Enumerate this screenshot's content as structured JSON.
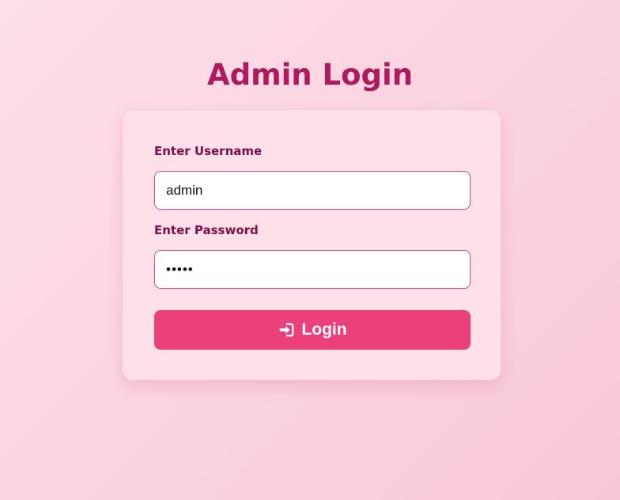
{
  "page": {
    "title": "Admin Login",
    "colors": {
      "title": "#b0195b",
      "label": "#7f0d45",
      "button": "#ec407a",
      "input_border": "#e0478a",
      "card_background": "#fde0e8"
    }
  },
  "form": {
    "username": {
      "label": "Enter Username",
      "value": "admin"
    },
    "password": {
      "label": "Enter Password",
      "value": "admin"
    },
    "login_button": {
      "label": "Login",
      "icon": "sign-in-icon"
    }
  }
}
